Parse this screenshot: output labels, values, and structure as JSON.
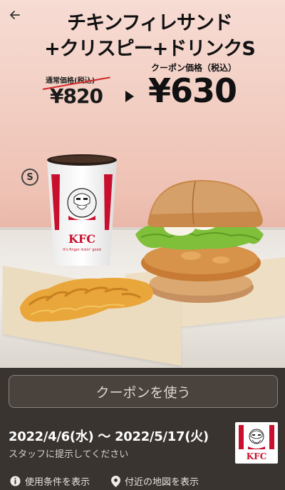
{
  "coupon": {
    "title_line1": "チキンフィレサンド",
    "title_line2": "+クリスピー+ドリンクS",
    "regular_label": "通常価格(税込)",
    "regular_price": "¥820",
    "coupon_label": "クーポン価格（税込）",
    "coupon_price": "¥630",
    "size_badge": "S"
  },
  "cup": {
    "brand": "KFC",
    "tagline": "It's finger lickin' good"
  },
  "actions": {
    "use_button": "クーポンを使う"
  },
  "validity": {
    "period": "2022/4/6(水) 〜 2022/5/17(火)",
    "note": "スタッフに提示してください"
  },
  "logo": {
    "brand": "KFC"
  },
  "links": {
    "terms": "使用条件を表示",
    "map": "付近の地図を表示"
  },
  "colors": {
    "panel_bg": "#3a3430",
    "hero_pink": "#eec2b4",
    "kfc_red": "#c8102e",
    "strike_red": "#d12a2a"
  },
  "icons": {
    "back": "back-arrow-icon",
    "info": "info-icon",
    "map_pin": "map-pin-icon"
  }
}
